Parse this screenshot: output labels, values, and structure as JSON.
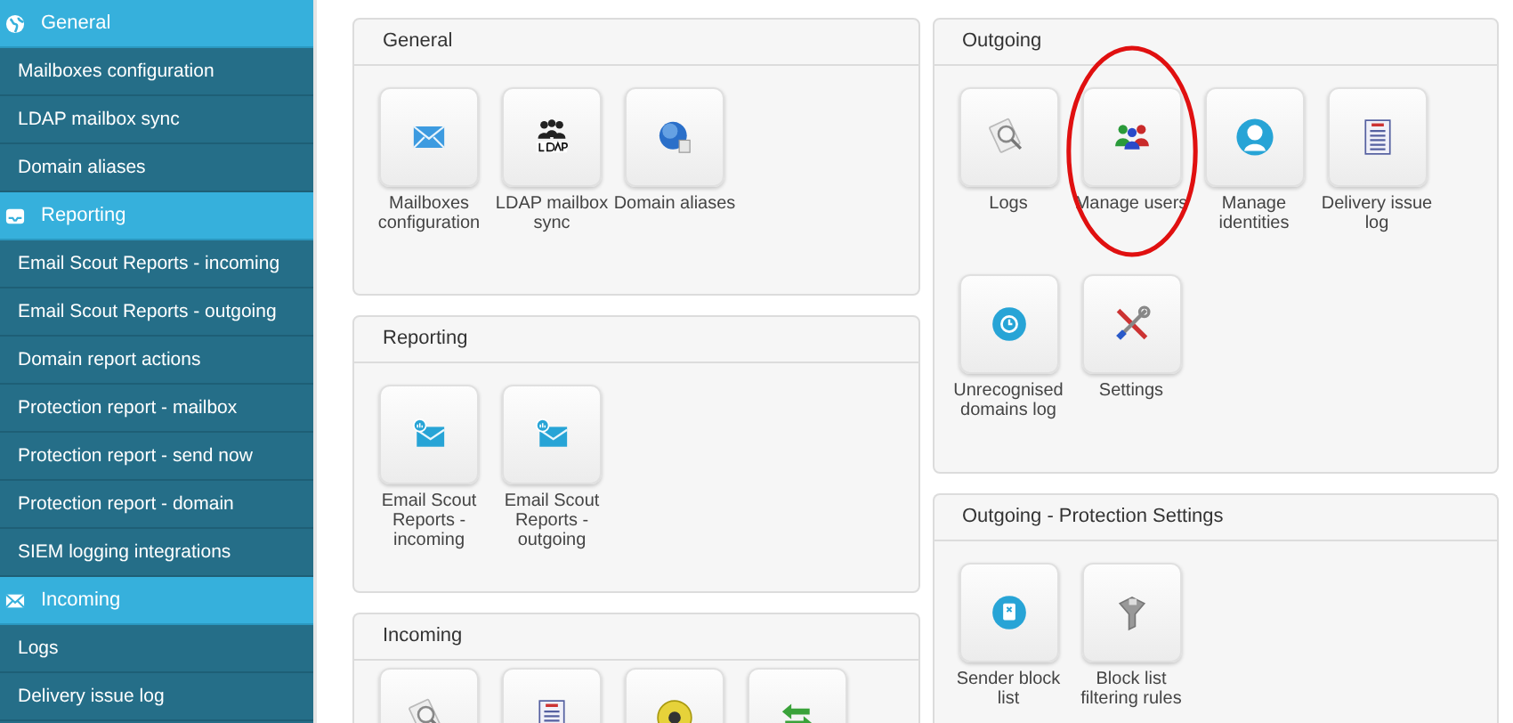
{
  "sidebar": {
    "items": [
      {
        "kind": "header",
        "label": "General"
      },
      {
        "kind": "item",
        "label": "Mailboxes configuration"
      },
      {
        "kind": "item",
        "label": "LDAP mailbox sync"
      },
      {
        "kind": "item",
        "label": "Domain aliases"
      },
      {
        "kind": "header",
        "label": "Reporting"
      },
      {
        "kind": "item",
        "label": "Email Scout Reports - incoming"
      },
      {
        "kind": "item",
        "label": "Email Scout Reports - outgoing"
      },
      {
        "kind": "item",
        "label": "Domain report actions"
      },
      {
        "kind": "item",
        "label": "Protection report - mailbox"
      },
      {
        "kind": "item",
        "label": "Protection report - send now"
      },
      {
        "kind": "item",
        "label": "Protection report - domain"
      },
      {
        "kind": "item",
        "label": "SIEM logging integrations"
      },
      {
        "kind": "header",
        "label": "Incoming"
      },
      {
        "kind": "item",
        "label": "Logs"
      },
      {
        "kind": "item",
        "label": "Delivery issue log"
      }
    ]
  },
  "columns": [
    {
      "panels": [
        {
          "title": "General",
          "tiles": [
            {
              "kind": "envelope",
              "label": "Mailboxes configuration",
              "circled": false
            },
            {
              "kind": "ldap",
              "label": "LDAP mailbox sync",
              "circled": false
            },
            {
              "kind": "globe",
              "label": "Domain aliases",
              "circled": false
            }
          ]
        },
        {
          "title": "Reporting",
          "tiles": [
            {
              "kind": "report",
              "label": "Email Scout Reports - incoming",
              "circled": false
            },
            {
              "kind": "report",
              "label": "Email Scout Reports - outgoing",
              "circled": false
            }
          ]
        },
        {
          "title": "Incoming",
          "tiles": [
            {
              "kind": "magnifier"
            },
            {
              "kind": "document"
            },
            {
              "kind": "biohazard"
            },
            {
              "kind": "arrows"
            }
          ]
        }
      ]
    },
    {
      "panels": [
        {
          "title": "Outgoing",
          "tiles": [
            {
              "kind": "magnifier",
              "label": "Logs",
              "circled": false
            },
            {
              "kind": "users",
              "label": "Manage users",
              "circled": true
            },
            {
              "kind": "person",
              "label": "Manage identities",
              "circled": false
            },
            {
              "kind": "document",
              "label": "Delivery issue log",
              "circled": false
            },
            {
              "kind": "clock",
              "label": "Unrecognised domains log",
              "circled": false
            },
            {
              "kind": "tools",
              "label": "Settings",
              "circled": false
            }
          ]
        },
        {
          "title": "Outgoing - Protection Settings",
          "tiles": [
            {
              "kind": "blocklist",
              "label": "Sender block list",
              "circled": false
            },
            {
              "kind": "funnel",
              "label": "Block list filtering rules",
              "circled": false
            }
          ]
        }
      ]
    }
  ]
}
